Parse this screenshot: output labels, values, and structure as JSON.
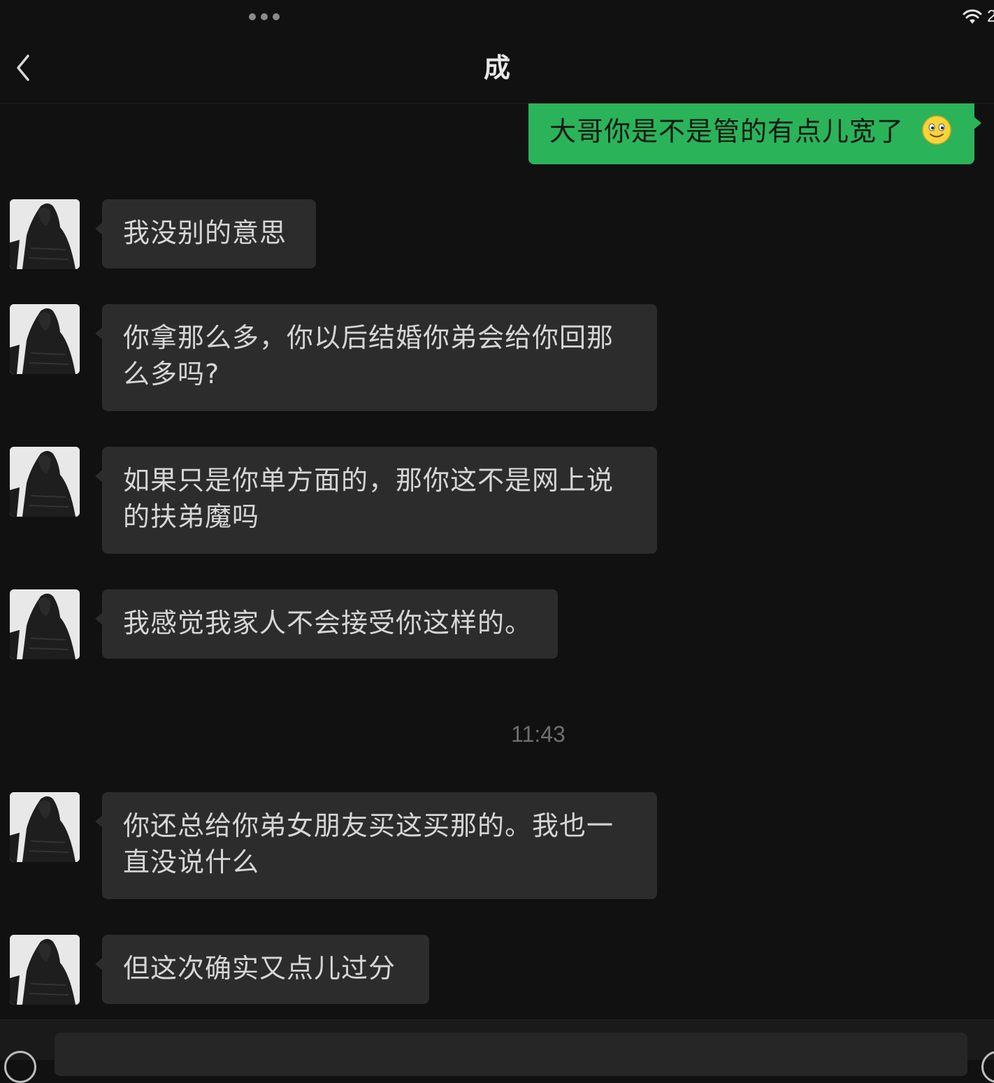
{
  "status_bar": {
    "battery_partial": "2"
  },
  "header": {
    "title": "成"
  },
  "sent_message": {
    "text": "大哥你是不是管的有点儿宽了"
  },
  "messages": [
    {
      "text": "我没别的意思"
    },
    {
      "text": "你拿那么多，你以后结婚你弟会给你回那么多吗?"
    },
    {
      "text": "如果只是你单方面的，那你这不是网上说的扶弟魔吗"
    },
    {
      "text": "我感觉我家人不会接受你这样的。"
    },
    {
      "text": "你还总给你弟女朋友买这买那的。我也一直没说什么"
    },
    {
      "text": "但这次确实又点儿过分"
    }
  ],
  "timestamp": "11:43",
  "colors": {
    "background": "#111111",
    "sent_bubble": "#2bb35a",
    "received_bubble": "#2c2c2c"
  },
  "icons": {
    "back": "chevron-left-icon",
    "wifi": "wifi-icon",
    "emoji": "smiley-emoji-icon"
  }
}
